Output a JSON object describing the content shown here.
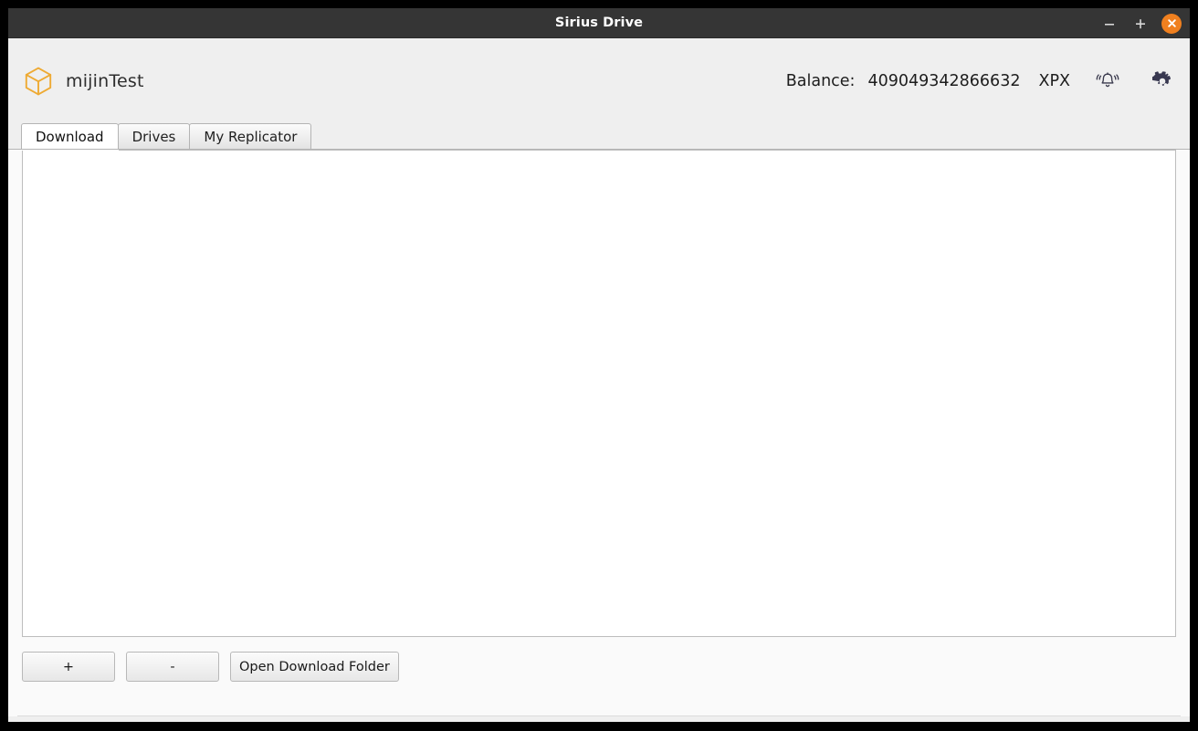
{
  "window": {
    "title": "Sirius Drive",
    "controls": {
      "minimize_label": "–",
      "maximize_label": "+",
      "close_label": "×",
      "minimize_icon": "minimize-icon",
      "maximize_icon": "maximize-icon",
      "close_icon": "close-icon"
    },
    "titlebar_color": "#353535",
    "close_button_color": "#f0801f"
  },
  "header": {
    "logo_icon": "cube-logo-icon",
    "logo_color": "#eeaa33",
    "brand_name": "mijinTest",
    "balance": {
      "label": "Balance:",
      "value": "409049342866632",
      "ticker": "XPX"
    },
    "notification_icon": "bell-icon",
    "settings_icon": "gear-icon",
    "icon_color": "#383850",
    "background": "#efefef"
  },
  "tabs": [
    {
      "label": "Download",
      "active": true
    },
    {
      "label": "Drives",
      "active": false
    },
    {
      "label": "My Replicator",
      "active": false
    }
  ],
  "download_panel": {
    "list": {
      "items": [],
      "empty": true
    },
    "buttons": {
      "add_label": "+",
      "remove_label": "-",
      "open_folder_label": "Open Download Folder"
    }
  }
}
